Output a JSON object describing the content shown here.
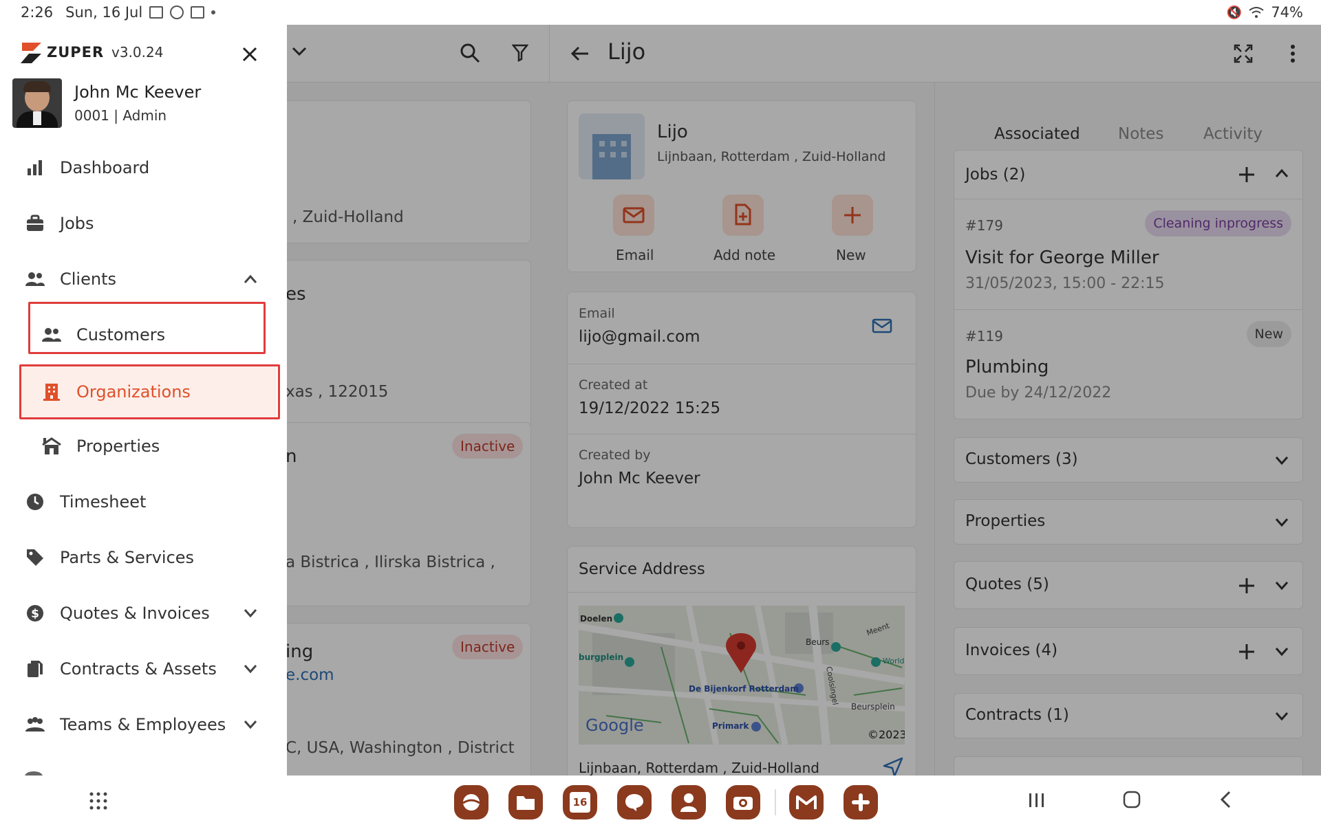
{
  "status_bar": {
    "time": "2:26",
    "date": "Sun, 16 Jul",
    "battery": "74%"
  },
  "drawer": {
    "brand": "ZUPER",
    "version": "v3.0.24",
    "user_name": "John Mc Keever",
    "user_meta": "0001 | Admin",
    "items": [
      {
        "label": "Dashboard",
        "icon": "bar-chart-icon"
      },
      {
        "label": "Jobs",
        "icon": "briefcase-icon"
      },
      {
        "label": "Clients",
        "icon": "people-icon",
        "expanded": true
      },
      {
        "label": "Customers",
        "icon": "people-icon"
      },
      {
        "label": "Organizations",
        "icon": "building-icon",
        "selected": true
      },
      {
        "label": "Properties",
        "icon": "property-icon"
      },
      {
        "label": "Timesheet",
        "icon": "clock-icon"
      },
      {
        "label": "Parts & Services",
        "icon": "tag-icon"
      },
      {
        "label": "Quotes & Invoices",
        "icon": "dollar-icon"
      },
      {
        "label": "Contracts & Assets",
        "icon": "documents-icon"
      },
      {
        "label": "Teams & Employees",
        "icon": "team-icon"
      }
    ]
  },
  "list": {
    "cards": [
      {
        "line": ", Zuid-Holland"
      },
      {
        "title": "es",
        "line": "xas , 122015"
      },
      {
        "title": "n",
        "badge": "Inactive",
        "line": "a Bistrica , Ilirska Bistrica ,"
      },
      {
        "title": "ing",
        "link": "e.com",
        "badge": "Inactive",
        "line": "C, USA, Washington , District"
      }
    ]
  },
  "detail": {
    "title": "Lijo",
    "org_name": "Lijo",
    "org_address": "Lijnbaan, Rotterdam , Zuid-Holland",
    "actions": [
      {
        "label": "Email"
      },
      {
        "label": "Add note"
      },
      {
        "label": "New"
      }
    ],
    "email_label": "Email",
    "email_value": "lijo@gmail.com",
    "created_at_label": "Created at",
    "created_at_value": "19/12/2022 15:25",
    "created_by_label": "Created by",
    "created_by_value": "John Mc Keever",
    "service_address_label": "Service Address",
    "map": {
      "labels": [
        "Doelen",
        "Beurs",
        "Meent",
        "World Cent",
        "burgplein",
        "De Bijenkorf Rotterdam",
        "Coolsingel",
        "Beursplein",
        "Primark",
        "Google",
        "©2023"
      ]
    },
    "service_address_value": "Lijnbaan, Rotterdam , Zuid-Holland"
  },
  "right": {
    "tabs": [
      {
        "label": "Associated",
        "active": true
      },
      {
        "label": "Notes"
      },
      {
        "label": "Activity"
      }
    ],
    "jobs_header": "Jobs (2)",
    "jobs": [
      {
        "number": "#179",
        "status": "Cleaning inprogress",
        "title": "Visit for George Miller",
        "sub": "31/05/2023, 15:00 - 22:15"
      },
      {
        "number": "#119",
        "status": "New",
        "title": "Plumbing",
        "sub": "Due by 24/12/2022"
      }
    ],
    "sections": [
      {
        "label": "Customers (3)",
        "plus": false
      },
      {
        "label": "Properties",
        "plus": false
      },
      {
        "label": "Quotes (5)",
        "plus": true
      },
      {
        "label": "Invoices (4)",
        "plus": true
      },
      {
        "label": "Contracts (1)",
        "plus": false
      }
    ]
  },
  "dock": {
    "calendar_day": "16"
  },
  "colors": {
    "accent": "#e0502a",
    "selected_bg": "#fdeee9",
    "highlight_border": "#e03c3c",
    "link": "#2e6fb5"
  }
}
